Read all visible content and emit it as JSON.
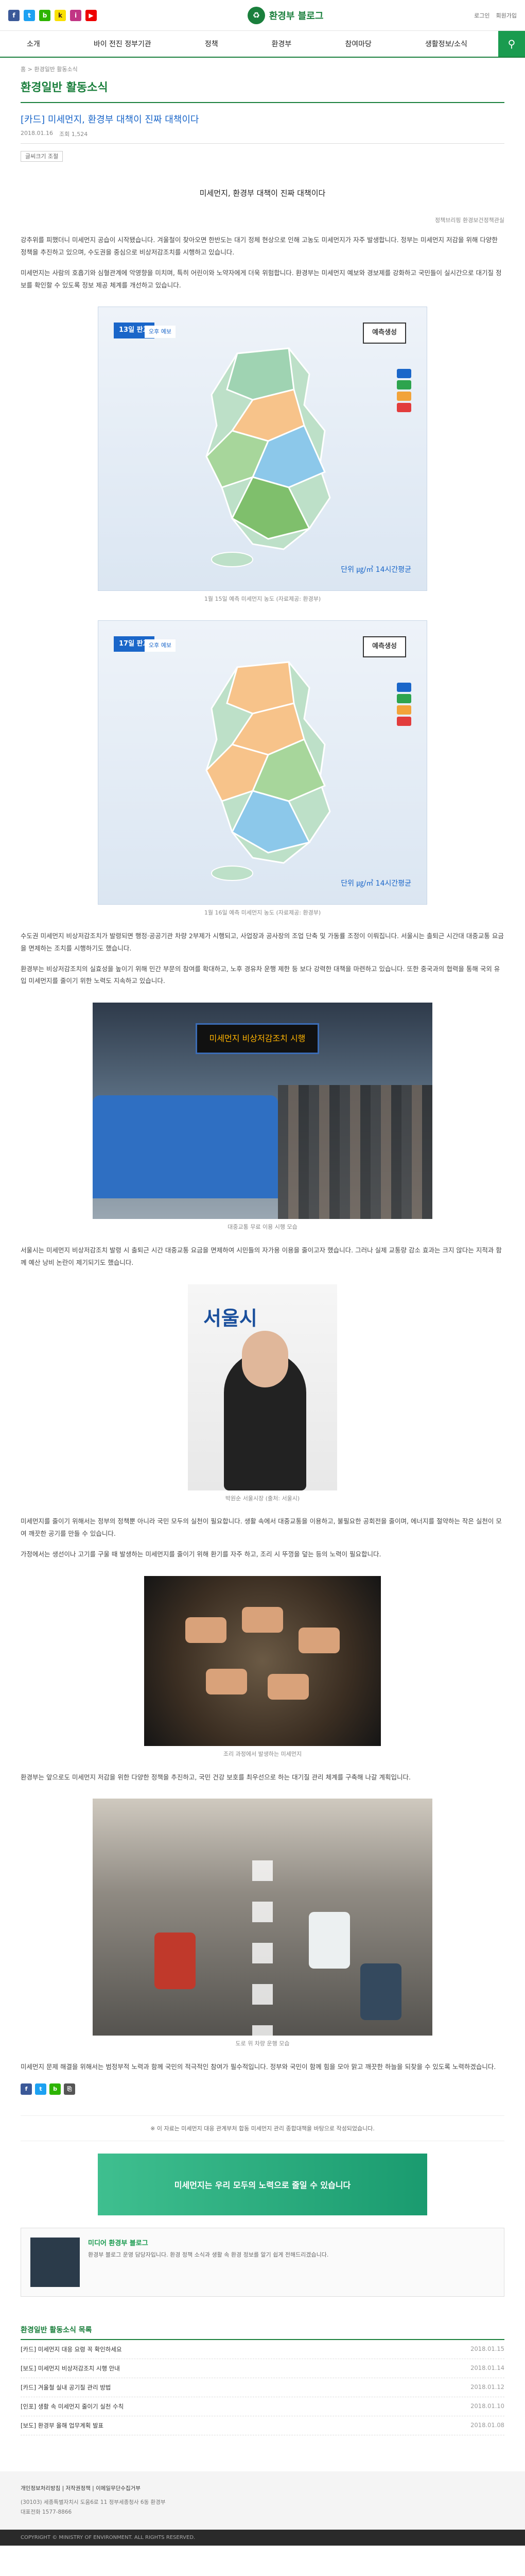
{
  "header": {
    "site_name": "환경부 블로그",
    "top_links": [
      "로그인",
      "회원가입"
    ],
    "social_icons": [
      "facebook-icon",
      "twitter-icon",
      "blog-icon",
      "kakao-icon",
      "instagram-icon",
      "youtube-icon"
    ]
  },
  "nav": {
    "items": [
      "소개",
      "바이 전진 정부기관",
      "정책",
      "환경부",
      "참여마당",
      "생활정보/소식"
    ],
    "search_label": "검색"
  },
  "breadcrumb": "홈 > 환경일반 활동소식",
  "section_title": "환경일반 활동소식",
  "article": {
    "title": "[카드] 미세먼지, 환경부 대책이 진짜 대책이다",
    "date": "2018.01.16",
    "views": "조회 1,524",
    "font_label": "글씨크기 조절",
    "center_title": "미세먼지, 환경부 대책이 진짜 대책이다",
    "source": "정책브리핑 환경보건정책관실",
    "paragraphs": [
      "강추위를 피했더니 미세먼지 공습이 시작됐습니다. 겨울철이 찾아오면 한반도는 대기 정체 현상으로 인해 고농도 미세먼지가 자주 발생합니다. 정부는 미세먼지 저감을 위해 다양한 정책을 추진하고 있으며, 수도권을 중심으로 비상저감조치를 시행하고 있습니다.",
      "미세먼지는 사람의 호흡기와 심혈관계에 악영향을 미치며, 특히 어린이와 노약자에게 더욱 위험합니다. 환경부는 미세먼지 예보와 경보제를 강화하고 국민들이 실시간으로 대기질 정보를 확인할 수 있도록 정보 제공 체계를 개선하고 있습니다."
    ],
    "map1_caption": "1월 15일 예측 미세먼지 농도 (자료제공: 환경부)",
    "map2_caption": "1월 16일 예측 미세먼지 농도 (자료제공: 환경부)",
    "paragraphs2": [
      "수도권 미세먼지 비상저감조치가 발령되면 행정·공공기관 차량 2부제가 시행되고, 사업장과 공사장의 조업 단축 및 가동률 조정이 이뤄집니다. 서울시는 출퇴근 시간대 대중교통 요금을 면제하는 조치를 시행하기도 했습니다.",
      "환경부는 비상저감조치의 실효성을 높이기 위해 민간 부문의 참여를 확대하고, 노후 경유차 운행 제한 등 보다 강력한 대책을 마련하고 있습니다. 또한 중국과의 협력을 통해 국외 유입 미세먼지를 줄이기 위한 노력도 지속하고 있습니다."
    ],
    "bus_caption": "대중교통 무료 이용 시행 모습",
    "bus_sign": "미세먼지 비상저감조치 시행",
    "paragraphs3": [
      "서울시는 미세먼지 비상저감조치 발령 시 출퇴근 시간 대중교통 요금을 면제하여 시민들의 자가용 이용을 줄이고자 했습니다. 그러나 실제 교통량 감소 효과는 크지 않다는 지적과 함께 예산 낭비 논란이 제기되기도 했습니다."
    ],
    "mayor_caption": "박원순 서울시장 (출처: 서울시)",
    "mayor_sign": "서울시",
    "paragraphs4": [
      "미세먼지를 줄이기 위해서는 정부의 정책뿐 아니라 국민 모두의 실천이 필요합니다. 생활 속에서 대중교통을 이용하고, 불필요한 공회전을 줄이며, 에너지를 절약하는 작은 실천이 모여 깨끗한 공기를 만들 수 있습니다.",
      "가정에서는 생선이나 고기를 구울 때 발생하는 미세먼지를 줄이기 위해 환기를 자주 하고, 조리 시 뚜껑을 덮는 등의 노력이 필요합니다."
    ],
    "grill_caption": "조리 과정에서 발생하는 미세먼지",
    "paragraphs5": [
      "환경부는 앞으로도 미세먼지 저감을 위한 다양한 정책을 추진하고, 국민 건강 보호를 최우선으로 하는 대기질 관리 체계를 구축해 나갈 계획입니다."
    ],
    "road_caption": "도로 위 차량 운행 모습",
    "paragraphs6": [
      "미세먼지 문제 해결을 위해서는 범정부적 노력과 함께 국민의 적극적인 참여가 필수적입니다. 정부와 국민이 함께 힘을 모아 맑고 깨끗한 하늘을 되찾을 수 있도록 노력하겠습니다."
    ]
  },
  "map1": {
    "date_label": "13일 판교",
    "forecast_label": "오후 예보",
    "region_label": "예측생성",
    "footer": "단위 ㎍/㎥ 14시간평균"
  },
  "map2": {
    "date_label": "17일 판교",
    "forecast_label": "오후 예보",
    "region_label": "예측생성",
    "footer": "단위 ㎍/㎥ 14시간평균"
  },
  "notice": "※ 이 자료는 미세먼지 대응 관계부처 합동 미세먼지 관리 종합대책을 바탕으로 작성되었습니다.",
  "banner": "미세먼지는 우리 모두의 노력으로 줄일 수 있습니다",
  "writer": {
    "name": "미디어 환경부 블로그",
    "desc": "환경부 블로그 운영 담당자입니다. 환경 정책 소식과 생활 속 환경 정보를 알기 쉽게 전해드리겠습니다."
  },
  "related": {
    "title": "환경일반 활동소식 목록",
    "items": [
      {
        "title": "[카드] 미세먼지 대응 요령 꼭 확인하세요",
        "date": "2018.01.15"
      },
      {
        "title": "[보도] 미세먼지 비상저감조치 시행 안내",
        "date": "2018.01.14"
      },
      {
        "title": "[카드] 겨울철 실내 공기질 관리 방법",
        "date": "2018.01.12"
      },
      {
        "title": "[인포] 생활 속 미세먼지 줄이기 실천 수칙",
        "date": "2018.01.10"
      },
      {
        "title": "[보도] 환경부 올해 업무계획 발표",
        "date": "2018.01.08"
      }
    ]
  },
  "footer": {
    "links": "개인정보처리방침 | 저작권정책 | 이메일무단수집거부",
    "address": "(30103) 세종특별자치시 도움6로 11 정부세종청사 6동 환경부",
    "tel": "대표전화 1577-8866",
    "copyright": "COPYRIGHT © MINISTRY OF ENVIRONMENT. ALL RIGHTS RESERVED."
  }
}
